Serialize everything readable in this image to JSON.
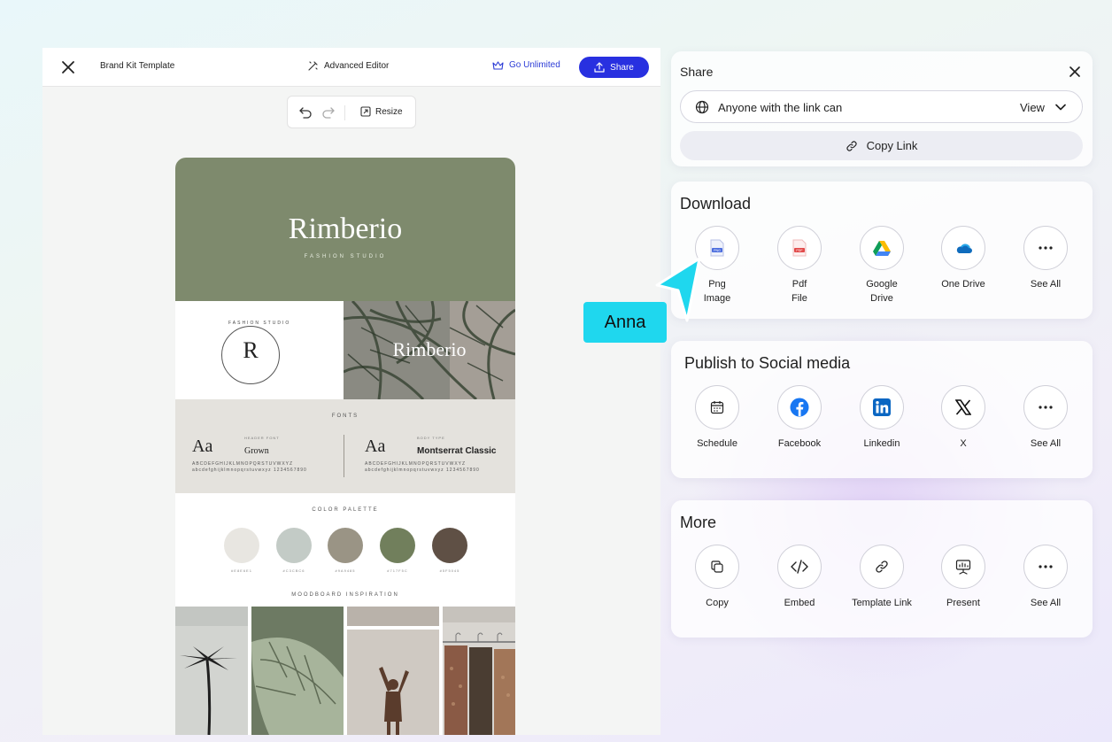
{
  "editor": {
    "title": "Brand Kit Template",
    "advanced_editor": "Advanced Editor",
    "go_unlimited": "Go Unlimited",
    "share_button": "Share",
    "resize": "Resize"
  },
  "design": {
    "brand_name": "Rimberio",
    "brand_sub": "FASHION STUDIO",
    "logo_letter": "R",
    "logo_ring": "FASHION STUDIO",
    "photo_title": "Rimberio",
    "fonts_heading": "FONTS",
    "header_font": {
      "sample": "Aa",
      "tag": "HEADER FONT",
      "name": "Grown",
      "alphabet": "ABCDEFGHIJKLMNOPQRSTUVWXYZ abcdefghijklmnopqrstuvwxyz 1234567890"
    },
    "body_font": {
      "sample": "Aa",
      "tag": "BODY TYPE",
      "name": "Montserrat Classic",
      "alphabet": "ABCDEFGHIJKLMNOPQRSTUVWXYZ abcdefghijklmnopqrstuvwxyz 1234567890"
    },
    "palette_heading": "COLOR PALETTE",
    "palette": [
      {
        "color": "#E8E6E1",
        "hex": "#E8E6E1"
      },
      {
        "color": "#C3CBC6",
        "hex": "#C3CBC6"
      },
      {
        "color": "#9A9485",
        "hex": "#9A9485"
      },
      {
        "color": "#717F5C",
        "hex": "#717F5C"
      },
      {
        "color": "#5F5045",
        "hex": "#5F5045"
      }
    ],
    "mood_heading": "MOODBOARD INSPIRATION"
  },
  "share": {
    "title": "Share",
    "link_access": "Anyone with the link can",
    "permission": "View",
    "copy_link": "Copy Link"
  },
  "download": {
    "title": "Download",
    "items": [
      {
        "label": "Png\nImage",
        "icon": "png-file-icon"
      },
      {
        "label": "Pdf\nFile",
        "icon": "pdf-file-icon"
      },
      {
        "label": "Google\nDrive",
        "icon": "google-drive-icon"
      },
      {
        "label": "One Drive",
        "icon": "onedrive-icon"
      },
      {
        "label": "See All",
        "icon": "more-icon"
      }
    ]
  },
  "social": {
    "title": "Publish to Social media",
    "items": [
      {
        "label": "Schedule",
        "icon": "calendar-icon"
      },
      {
        "label": "Facebook",
        "icon": "facebook-icon"
      },
      {
        "label": "Linkedin",
        "icon": "linkedin-icon"
      },
      {
        "label": "X",
        "icon": "x-icon"
      },
      {
        "label": "See All",
        "icon": "more-icon"
      }
    ]
  },
  "more": {
    "title": "More",
    "items": [
      {
        "label": "Copy",
        "icon": "copy-icon"
      },
      {
        "label": "Embed",
        "icon": "code-icon"
      },
      {
        "label": "Template Link",
        "icon": "link-icon"
      },
      {
        "label": "Present",
        "icon": "present-icon"
      },
      {
        "label": "See All",
        "icon": "more-icon"
      }
    ]
  },
  "cursor": {
    "user": "Anna",
    "color": "#1FD7EE"
  },
  "colors": {
    "accent": "#2830E0",
    "hero_green": "#7E8A6D"
  }
}
